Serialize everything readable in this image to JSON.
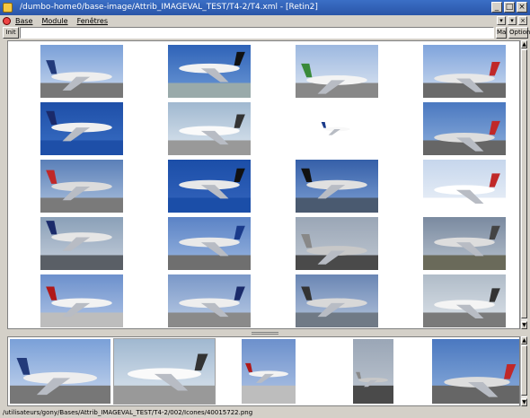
{
  "window": {
    "title": "/dumbo-home0/base-image/Attrib_IMAGEVAL_TEST/T4-2/T4.xml - [Retin2]",
    "controls": [
      "_",
      "□",
      "×"
    ]
  },
  "menubar": {
    "items": [
      "Base",
      "Module",
      "Fenêtres"
    ],
    "mdi_controls": [
      "▾",
      "▾",
      "×"
    ]
  },
  "toolbar": {
    "init_label": "Init",
    "search_value": "",
    "ma_label": "Ma",
    "options_label": "Options"
  },
  "grid": {
    "rows": [
      [
        "airliner on tarmac",
        "jet landing",
        "airliner at airport tower",
        "airliner taking off"
      ],
      [
        "jet in blue sky",
        "jet nose close-up",
        "jet tail fins",
        "control tower and flags"
      ],
      [
        "jet engine close-up",
        "jet tail star",
        "jets in formation",
        "jet wing over clouds"
      ],
      [
        "small jet on tarmac",
        "jumbo jet nose",
        "city street",
        "fighter jet and crew"
      ],
      [
        "jet tails",
        "jets on apron",
        "fighter jet front",
        "jet landing gear"
      ]
    ]
  },
  "strip": {
    "items": [
      "jumbo jet on apron",
      "jet tail on tarmac",
      "jet tail KLM",
      "city street scene",
      "flag and figure"
    ]
  },
  "status": {
    "path": "/utilisateurs/gony/Bases/Attrib_IMAGEVAL_TEST/T4-2/002/Icones/40015722.png"
  },
  "colors": {
    "titlebar": "#2a55a8",
    "window_bg": "#d4d0c8",
    "panel_bg": "#ffffff",
    "sky_blue": "#4a78c0"
  }
}
